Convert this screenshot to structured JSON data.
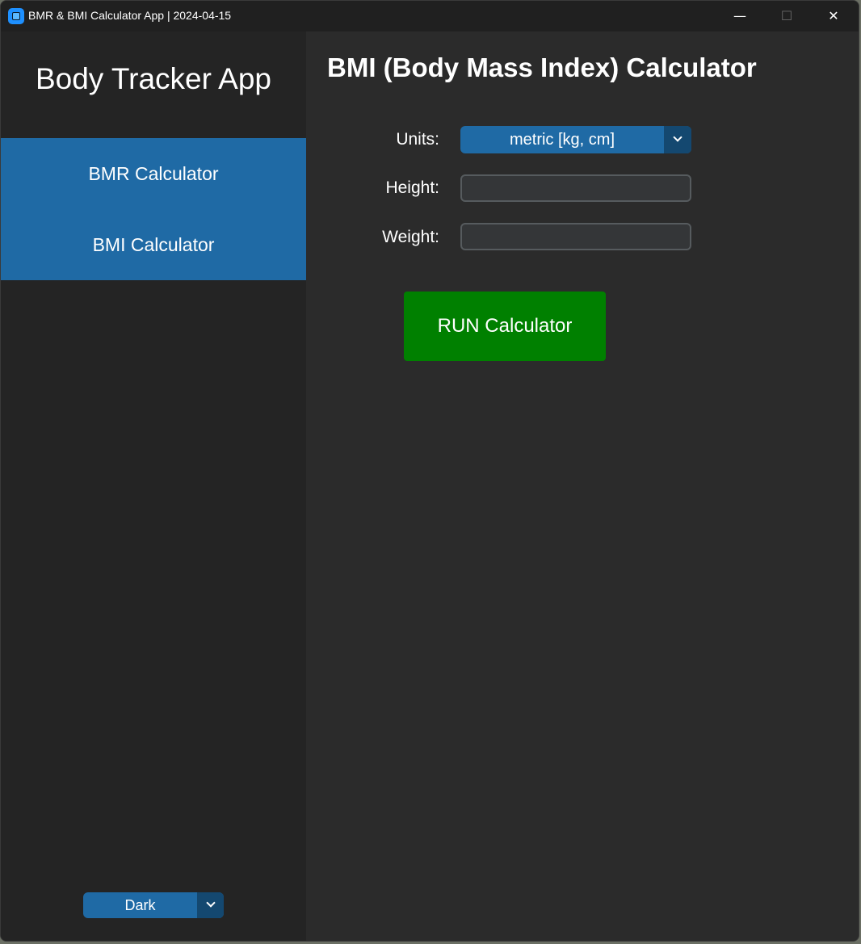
{
  "window": {
    "title": "BMR & BMI Calculator App | 2024-04-15",
    "app_icon": "app-icon",
    "controls": {
      "minimize": "—",
      "maximize": "☐",
      "close": "✕"
    }
  },
  "sidebar": {
    "title": "Body Tracker App",
    "nav": [
      {
        "label": "BMR Calculator"
      },
      {
        "label": "BMI Calculator"
      }
    ],
    "appearance": {
      "value": "Dark",
      "icon": "chevron-down-icon"
    }
  },
  "main": {
    "title": "BMI (Body Mass Index) Calculator",
    "fields": {
      "units_label": "Units:",
      "units_value": "metric [kg, cm]",
      "height_label": "Height:",
      "height_value": "",
      "weight_label": "Weight:",
      "weight_value": ""
    },
    "run_button": "RUN Calculator"
  },
  "colors": {
    "accent": "#1f6aa5",
    "accent_dark": "#144870",
    "run_button": "#008000",
    "background": "#2b2b2b",
    "sidebar": "#242424"
  }
}
